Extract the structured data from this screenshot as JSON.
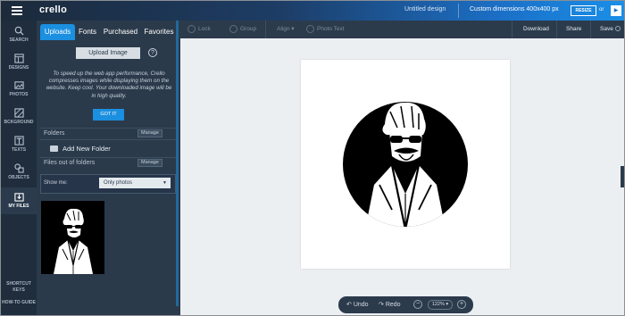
{
  "topbar": {
    "logo": "crello",
    "design_name": "Untitled design",
    "dimensions": "Custom dimensions 400x400 px",
    "resize_label": "RESIZE",
    "or_label": "or",
    "go_label": "▶"
  },
  "rail": {
    "items": [
      {
        "label": "SEARCH",
        "icon": "search-icon"
      },
      {
        "label": "DESIGNS",
        "icon": "designs-icon"
      },
      {
        "label": "PHOTOS",
        "icon": "photos-icon"
      },
      {
        "label": "BCKGROUND",
        "icon": "background-icon"
      },
      {
        "label": "TEXTS",
        "icon": "texts-icon"
      },
      {
        "label": "OBJECTS",
        "icon": "objects-icon"
      },
      {
        "label": "MY FILES",
        "icon": "my-files-icon"
      }
    ],
    "shortcut_keys": "SHORTCUT KEYS",
    "howto_guide": "HOW-TO GUIDE"
  },
  "panel": {
    "tabs": [
      "Uploads",
      "Fonts",
      "Purchased",
      "Favorites"
    ],
    "upload_button": "Upload Image",
    "help": "?",
    "notice": "To speed up the web app performance, Crello compresses images while displaying them on the website. Keep cool. Your downloaded image will be in high quality.",
    "gotit": "GOT IT",
    "folders_label": "Folders",
    "manage_label": "Manage",
    "add_folder": "Add New Folder",
    "files_label": "Files out of folders",
    "show_me_label": "Show me:",
    "show_me_value": "Only photos"
  },
  "toolbar": {
    "lock": "Lock",
    "group": "Group",
    "align": "Align ▾",
    "photo_text": "Photo Text",
    "download": "Download",
    "share": "Share",
    "save": "Save"
  },
  "bottombar": {
    "undo": "Undo",
    "redo": "Redo",
    "zoom": "122% ▾",
    "zoom_out": "−",
    "zoom_in": "+"
  }
}
